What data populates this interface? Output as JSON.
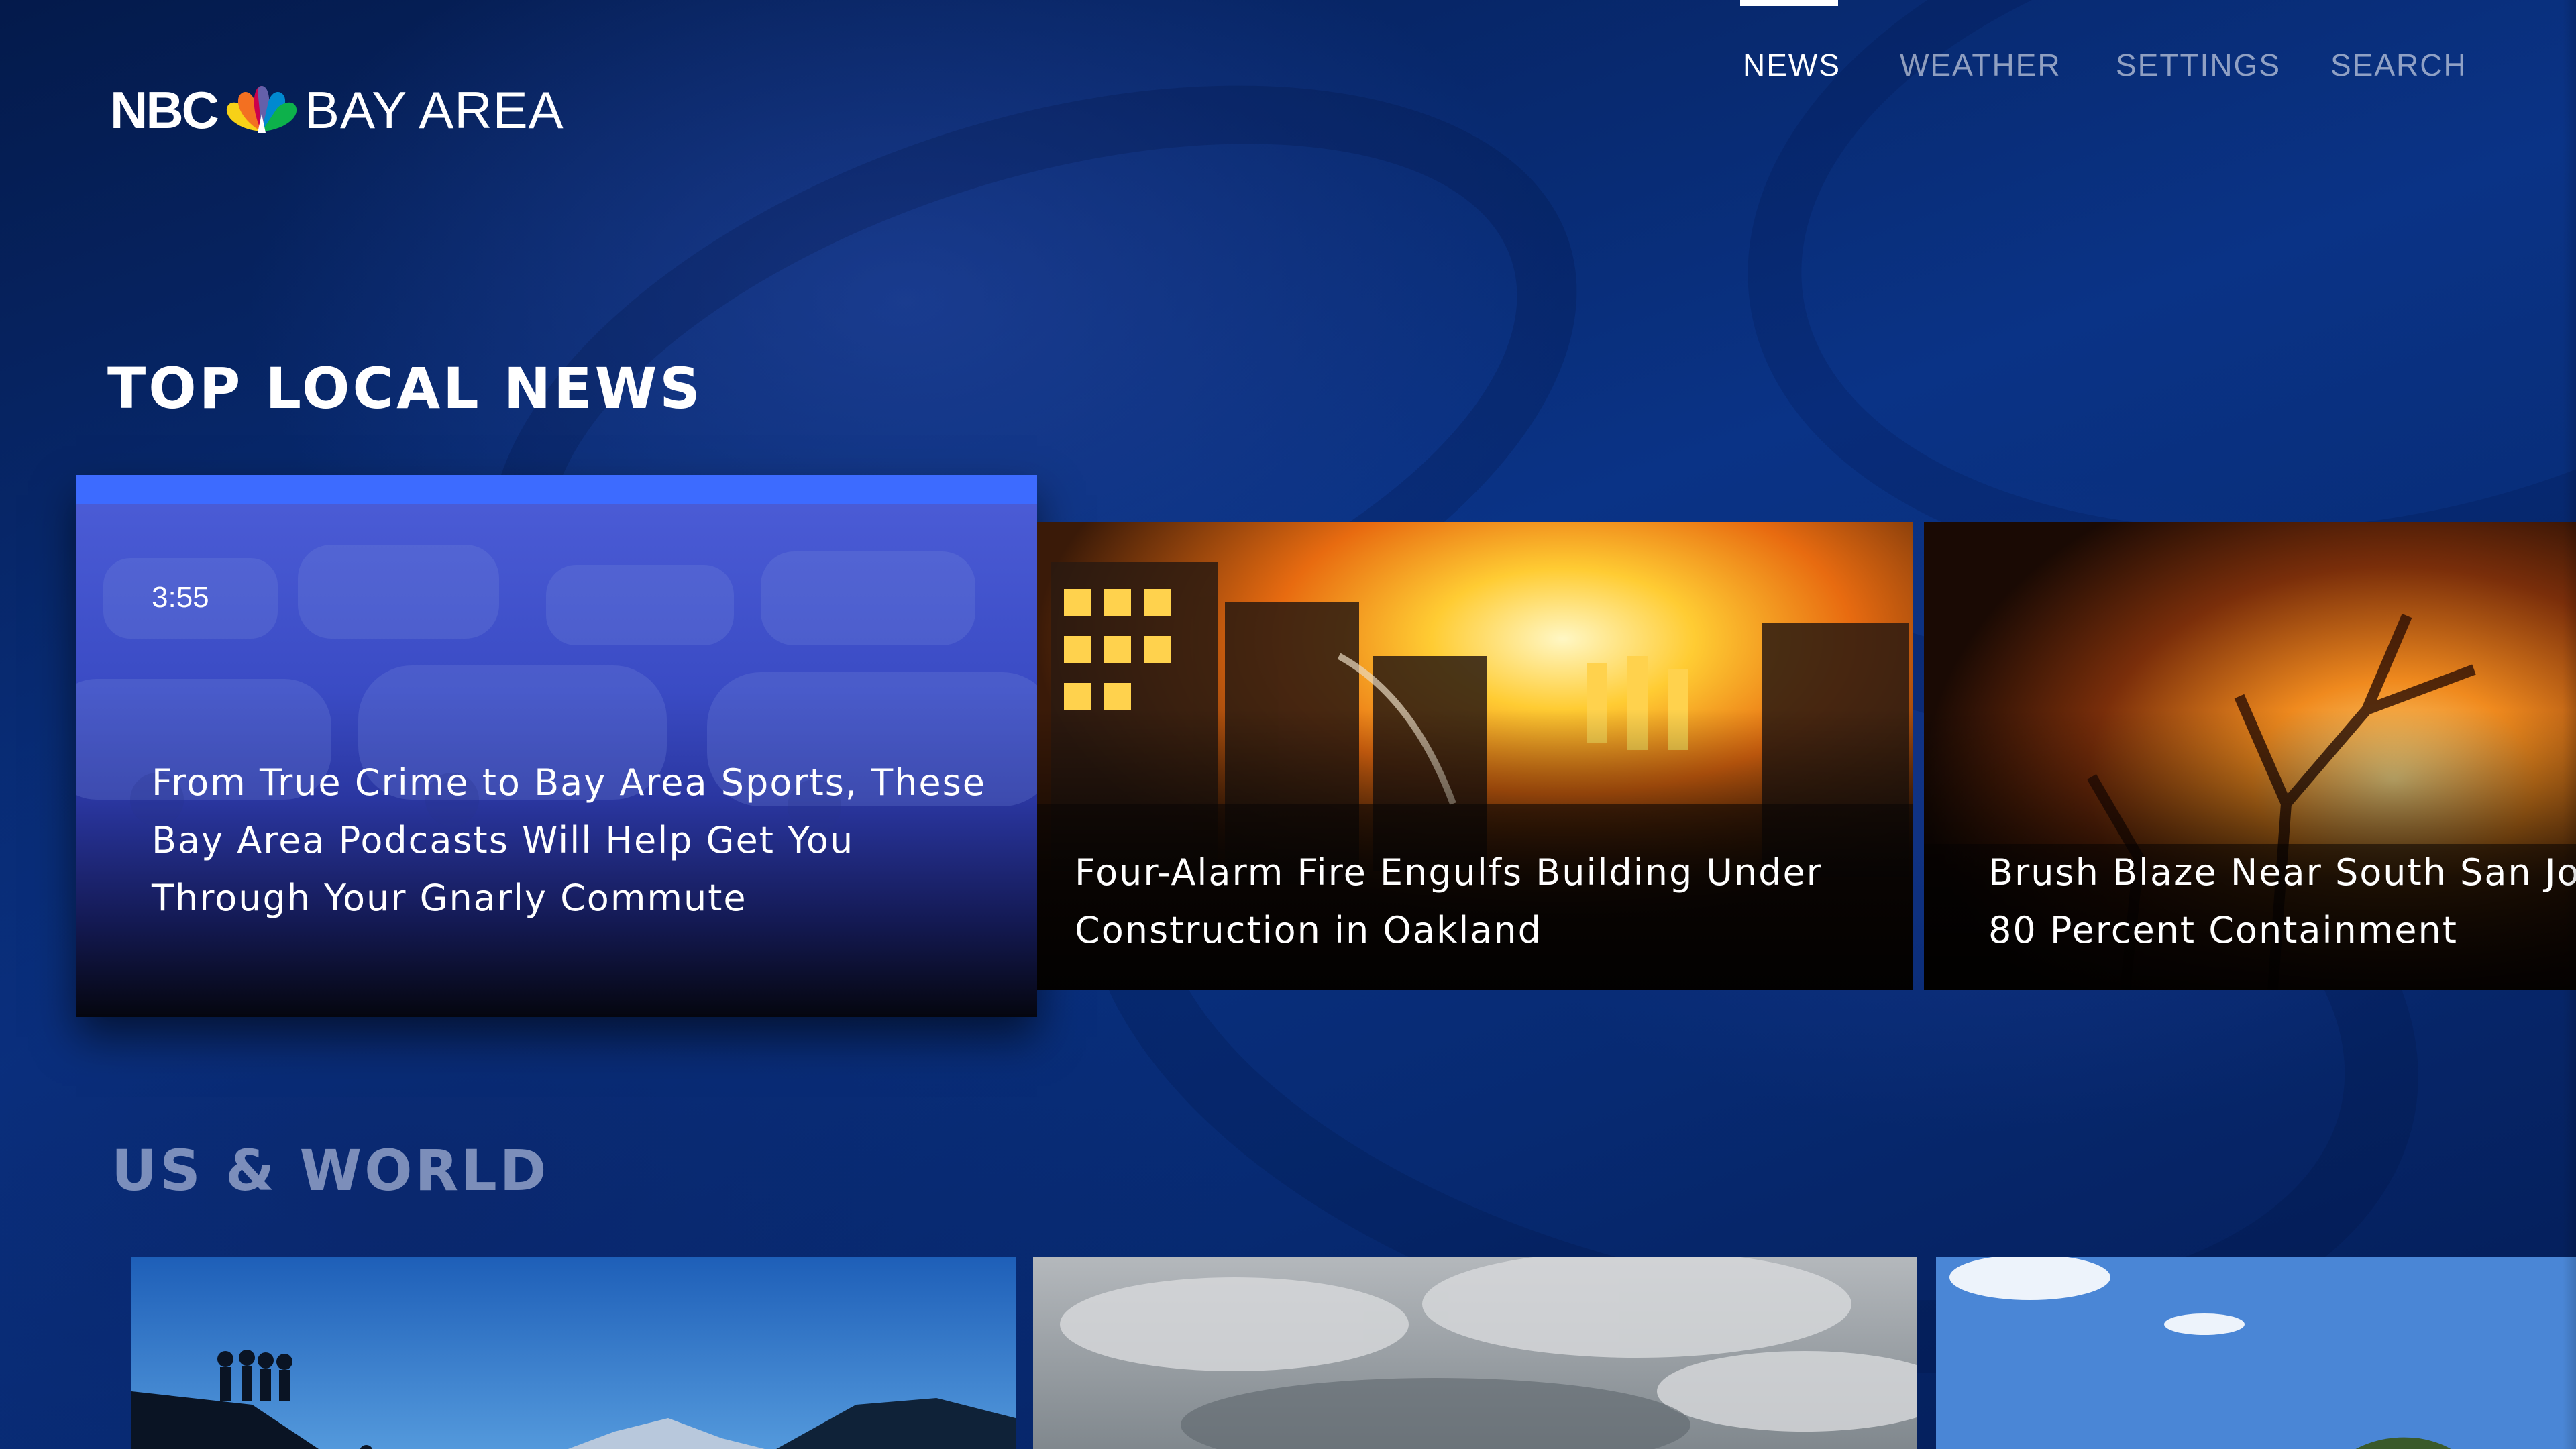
{
  "header": {
    "logo": {
      "nbc_text": "NBC",
      "area_text": "BAY AREA",
      "icon": "nbc-peacock-icon"
    },
    "nav": [
      {
        "label": "NEWS",
        "active": true
      },
      {
        "label": "WEATHER",
        "active": false
      },
      {
        "label": "SETTINGS",
        "active": false
      },
      {
        "label": "SEARCH",
        "active": false
      }
    ]
  },
  "sections": {
    "top_local": {
      "title": "TOP LOCAL NEWS",
      "cards": [
        {
          "duration": "3:55",
          "title_lines": [
            "From True Crime to Bay Area Sports, These",
            "Bay Area Podcasts Will Help Get You",
            "Through Your Gnarly Commute"
          ],
          "focused": true
        },
        {
          "title_lines": [
            "Four-Alarm Fire Engulfs Building Under",
            "Construction in Oakland"
          ]
        },
        {
          "title_lines": [
            "Brush Blaze Near South San Jos",
            "80 Percent Containment"
          ]
        }
      ]
    },
    "us_world": {
      "title": "US & WORLD"
    }
  },
  "colors": {
    "background": "#0a3386",
    "focus_bar": "#3d6bff",
    "text": "#ffffff",
    "nav_inactive": "#8e9fc6"
  }
}
